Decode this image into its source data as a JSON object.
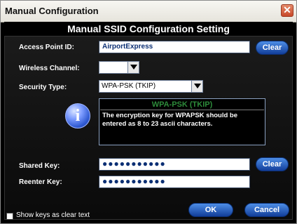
{
  "window": {
    "title": "Manual Configuration"
  },
  "header": {
    "title": "Manual SSID Configuration Setting"
  },
  "fields": {
    "access_point_label": "Access Point ID:",
    "access_point_value": "AirportExpress",
    "wireless_channel_label": "Wireless Channel:",
    "wireless_channel_value": "",
    "security_type_label": "Security Type:",
    "security_type_value": "WPA-PSK (TKIP)",
    "shared_key_label": "Shared Key:",
    "shared_key_value": "●●●●●●●●●●●",
    "reenter_key_label": "Reenter Key:",
    "reenter_key_value": "●●●●●●●●●●●"
  },
  "info": {
    "title": "WPA-PSK (TKIP)",
    "message": "The encryption key for WPAPSK should be entered as 8 to 23 ascii characters."
  },
  "buttons": {
    "clear_ssid": "Clear",
    "clear_key": "Clear",
    "ok": "OK",
    "cancel": "Cancel"
  },
  "checkbox": {
    "label": "Show keys as clear text",
    "checked": false
  }
}
